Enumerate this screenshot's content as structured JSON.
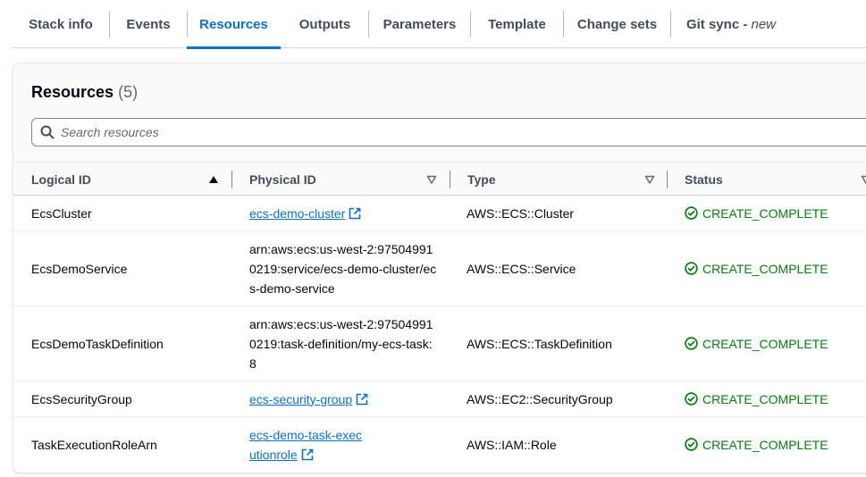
{
  "tabs": [
    {
      "label": "Stack info"
    },
    {
      "label": "Events"
    },
    {
      "label": "Resources",
      "active": true
    },
    {
      "label": "Outputs"
    },
    {
      "label": "Parameters"
    },
    {
      "label": "Template"
    },
    {
      "label": "Change sets"
    },
    {
      "label": "Git sync - ",
      "badge": "new"
    }
  ],
  "panel": {
    "title": "Resources",
    "count": "(5)"
  },
  "search": {
    "placeholder": "Search resources",
    "value": ""
  },
  "table": {
    "columns": [
      "Logical ID",
      "Physical ID",
      "Type",
      "Status"
    ],
    "sorted_column": "Logical ID",
    "rows": [
      {
        "logical_id": "EcsCluster",
        "physical_id": "ecs-demo-cluster",
        "physical_is_link": true,
        "type": "AWS::ECS::Cluster",
        "status": "CREATE_COMPLETE"
      },
      {
        "logical_id": "EcsDemoService",
        "physical_id": "arn:aws:ecs:us-west-2:975049910219:service/ecs-demo-cluster/ecs-demo-service",
        "physical_is_link": false,
        "type": "AWS::ECS::Service",
        "status": "CREATE_COMPLETE"
      },
      {
        "logical_id": "EcsDemoTaskDefinition",
        "physical_id": "arn:aws:ecs:us-west-2:975049910219:task-definition/my-ecs-task:8",
        "physical_is_link": false,
        "type": "AWS::ECS::TaskDefinition",
        "status": "CREATE_COMPLETE"
      },
      {
        "logical_id": "EcsSecurityGroup",
        "physical_id": "ecs-security-group",
        "physical_is_link": true,
        "type": "AWS::EC2::SecurityGroup",
        "status": "CREATE_COMPLETE"
      },
      {
        "logical_id": "TaskExecutionRoleArn",
        "physical_id": "ecs-demo-task-executionrole",
        "physical_is_link": true,
        "type": "AWS::IAM::Role",
        "status": "CREATE_COMPLETE"
      }
    ]
  },
  "colors": {
    "accent": "#0972d3",
    "success": "#037f0c",
    "text": "#000716",
    "muted": "#414d5c"
  },
  "icons": {
    "search": "search-icon",
    "sort_asc": "caret-up-icon",
    "sort_none": "caret-down-outline-icon",
    "external": "external-link-icon",
    "status_ok": "check-circle-icon"
  }
}
